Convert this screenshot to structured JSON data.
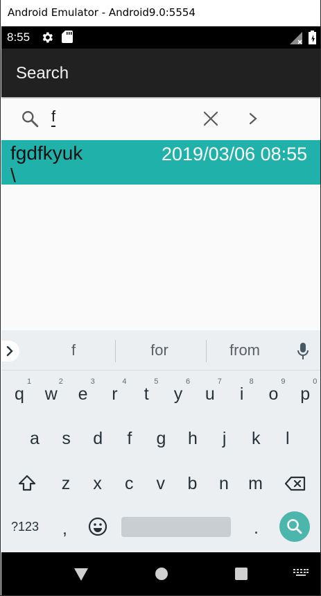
{
  "window": {
    "title": "Android Emulator - Android9.0:5554"
  },
  "statusbar": {
    "time": "8:55"
  },
  "appbar": {
    "title": "Search"
  },
  "search": {
    "query": "f"
  },
  "results": [
    {
      "name": "fgdfkyuk",
      "second_line": "\\",
      "date": "2019/03/06 08:55"
    }
  ],
  "keyboard": {
    "suggestions": [
      "f",
      "for",
      "from"
    ],
    "row1": [
      "q",
      "w",
      "e",
      "r",
      "t",
      "y",
      "u",
      "i",
      "o",
      "p"
    ],
    "row1_hints": [
      "1",
      "2",
      "3",
      "4",
      "5",
      "6",
      "7",
      "8",
      "9",
      "0"
    ],
    "row2": [
      "a",
      "s",
      "d",
      "f",
      "g",
      "h",
      "j",
      "k",
      "l"
    ],
    "row3": [
      "z",
      "x",
      "c",
      "v",
      "b",
      "n",
      "m"
    ],
    "symbols_label": "?123",
    "comma": ",",
    "period": "."
  },
  "colors": {
    "accent": "#20b2aa",
    "appbar": "#212121",
    "keyboard_bg": "#eceff1",
    "search_key": "#4db6ac"
  },
  "icons": [
    "gear-icon",
    "sd-card-icon",
    "signal-icon",
    "battery-icon",
    "search-icon",
    "clear-icon",
    "chevron-right-icon",
    "mic-icon",
    "shift-icon",
    "backspace-icon",
    "emoji-icon",
    "back-icon",
    "home-icon",
    "recents-icon",
    "keyboard-switch-icon"
  ]
}
